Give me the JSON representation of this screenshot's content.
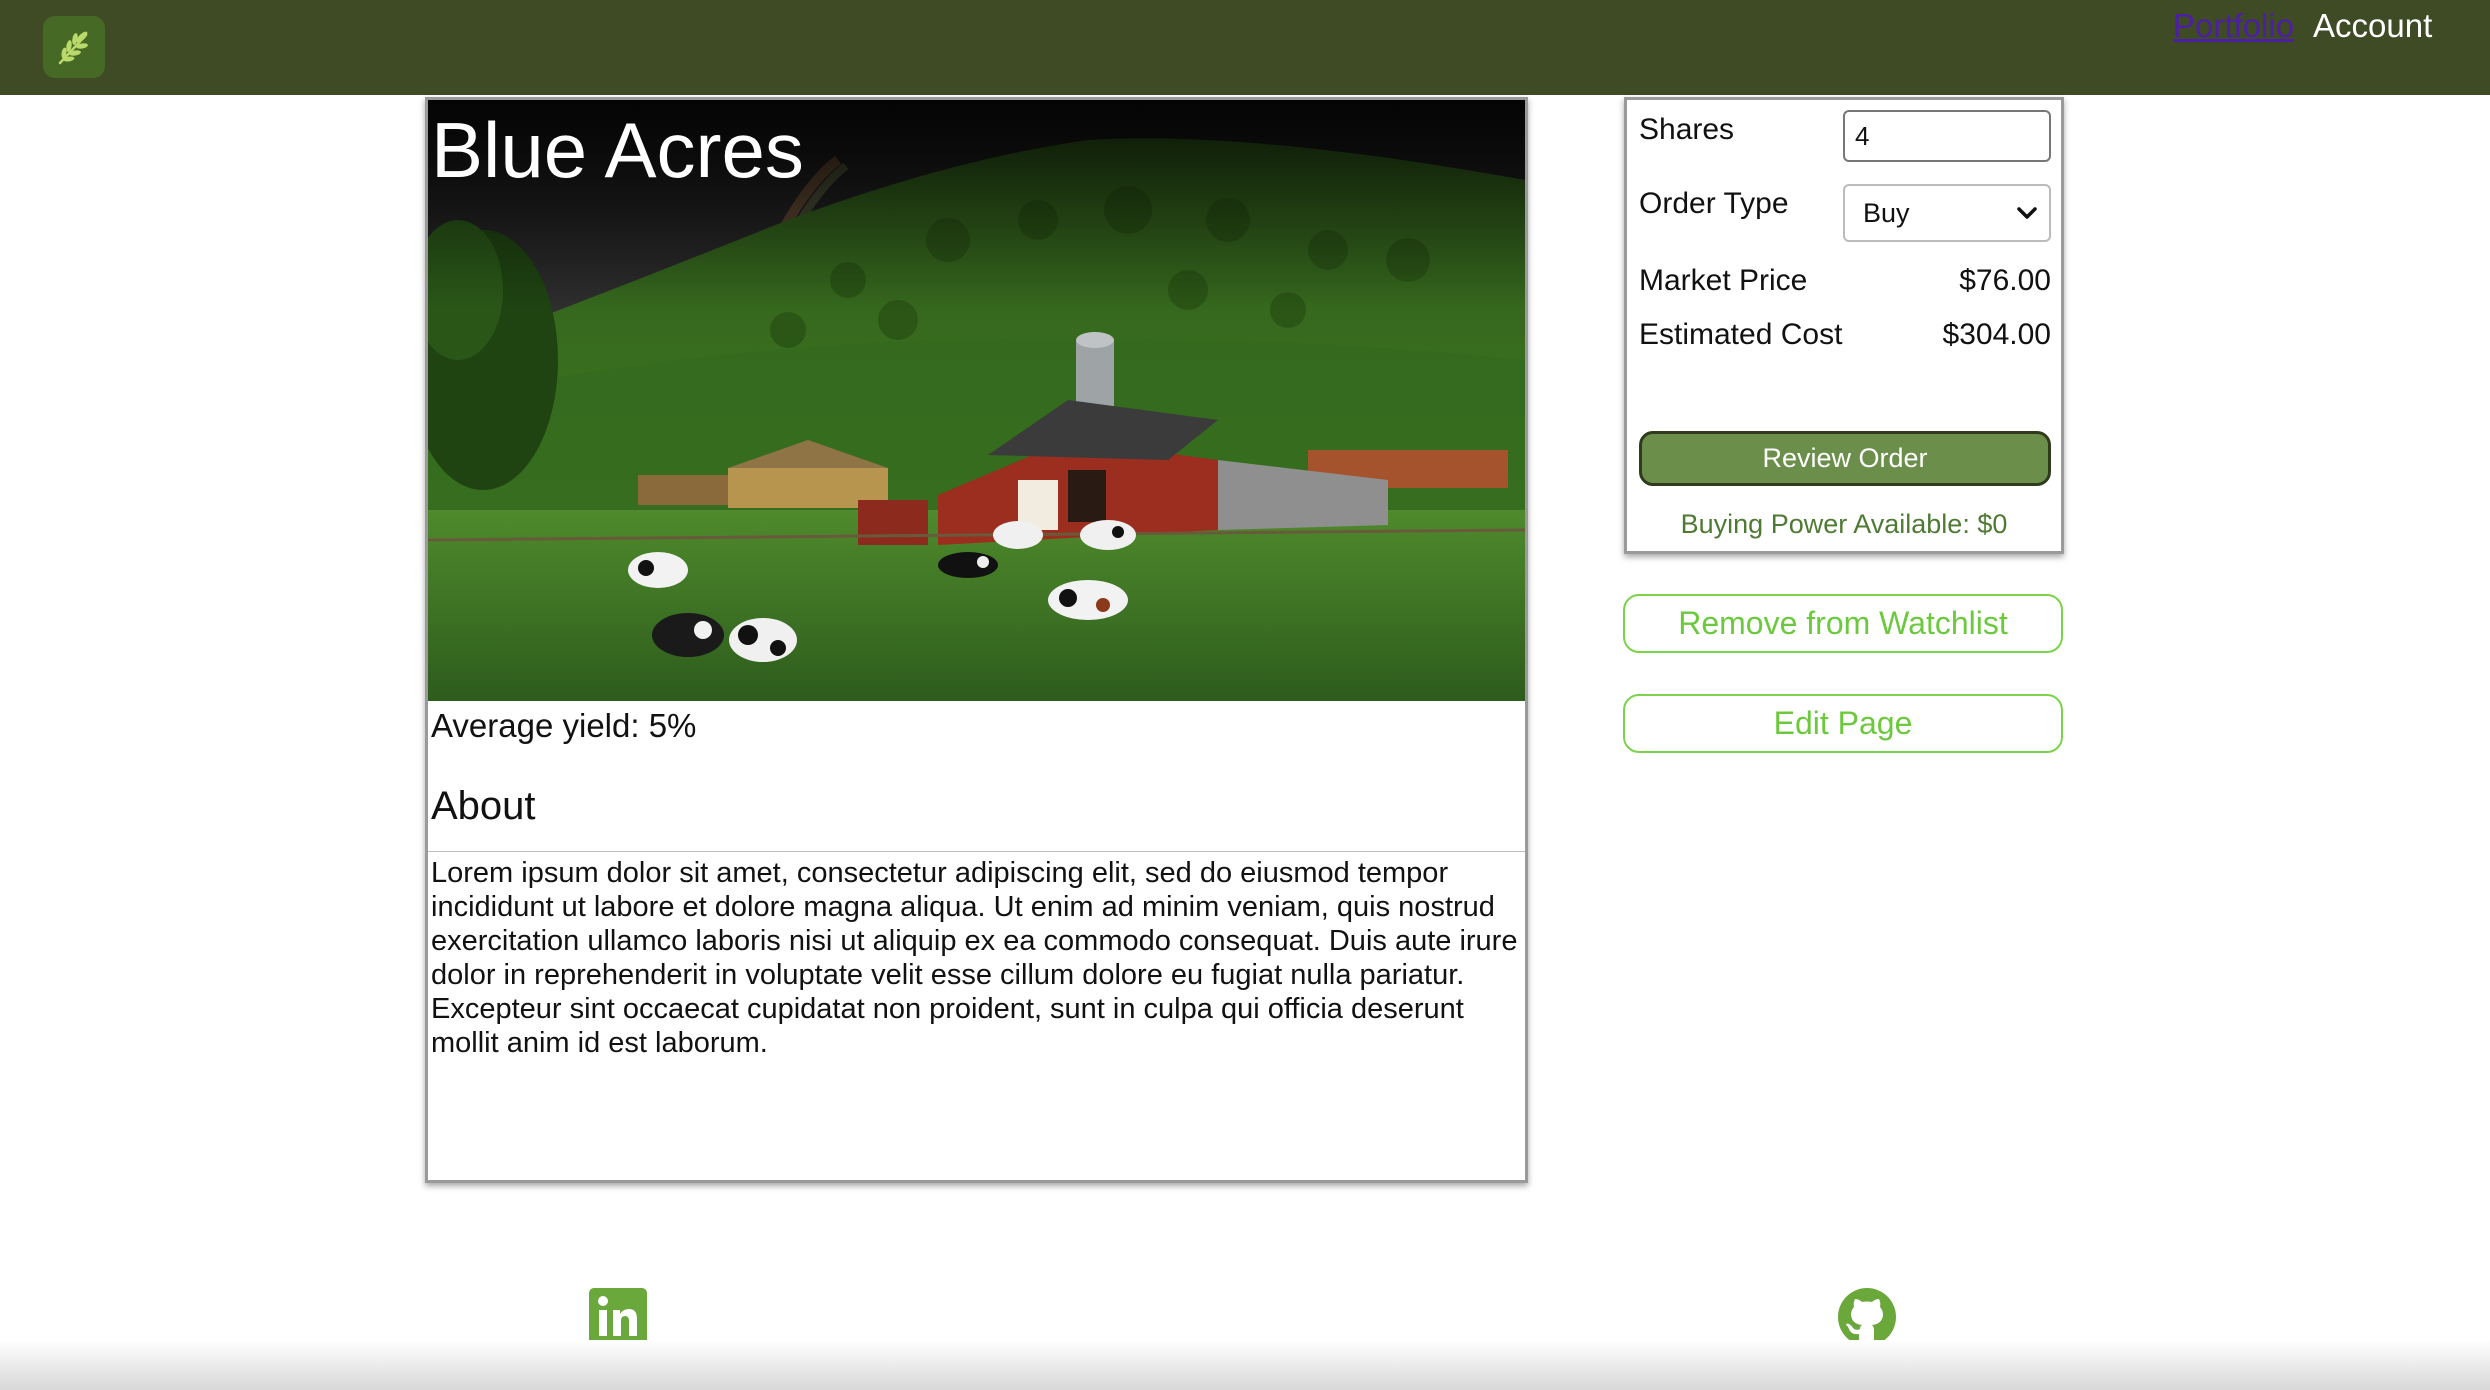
{
  "nav": {
    "logo_icon": "wheat-leaf-icon",
    "portfolio_label": "Portfolio",
    "account_label": "Account"
  },
  "farm": {
    "title": "Blue Acres",
    "image_description_icon": "farm-landscape-image",
    "yield_text": "Average yield: 5%",
    "about_heading": "About",
    "about_text": "Lorem ipsum dolor sit amet, consectetur adipiscing elit, sed do eiusmod tempor incididunt ut labore et dolore magna aliqua. Ut enim ad minim veniam, quis nostrud exercitation ullamco laboris nisi ut aliquip ex ea commodo consequat. Duis aute irure dolor in reprehenderit in voluptate velit esse cillum dolore eu fugiat nulla pariatur. Excepteur sint occaecat cupidatat non proident, sunt in culpa qui officia deserunt mollit anim id est laborum."
  },
  "order": {
    "shares_label": "Shares",
    "shares_value": "4",
    "order_type_label": "Order Type",
    "order_type_value": "Buy",
    "market_price_label": "Market Price",
    "market_price_value": "$76.00",
    "estimated_cost_label": "Estimated Cost",
    "estimated_cost_value": "$304.00",
    "review_button": "Review Order",
    "buying_power": "Buying Power Available: $0"
  },
  "actions": {
    "remove_watchlist": "Remove from Watchlist",
    "edit_page": "Edit Page"
  },
  "footer": {
    "linkedin_icon": "linkedin-icon",
    "github_icon": "github-icon"
  },
  "colors": {
    "nav_bg": "#3e4b24",
    "accent_green": "#6b8f4b",
    "outline_green": "#7bd34a",
    "footer_icon_green": "#6aa83c"
  }
}
